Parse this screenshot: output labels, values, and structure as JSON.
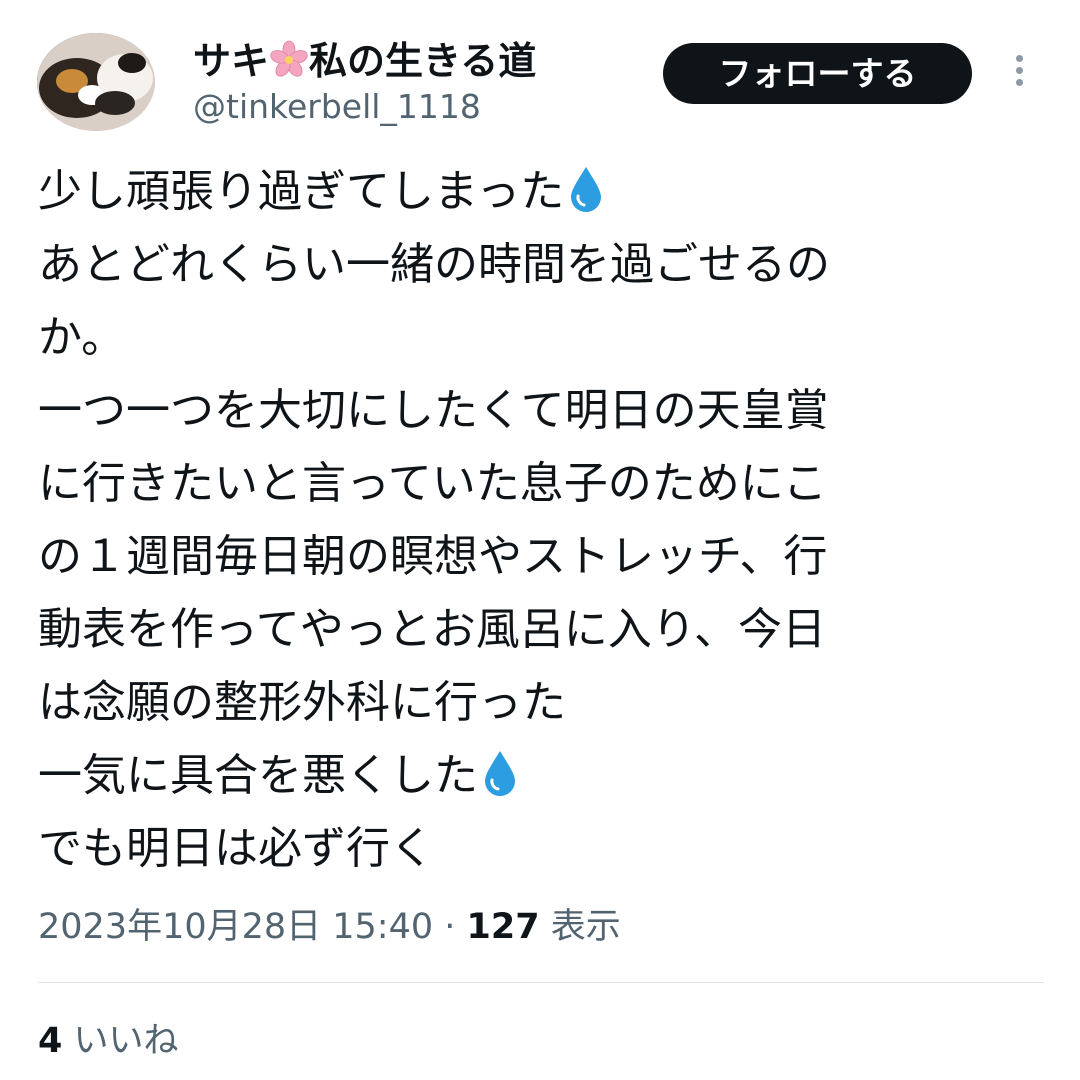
{
  "user": {
    "display_name_before": "サキ",
    "display_name_after": "私の生きる道",
    "handle": "@tinkerbell_1118"
  },
  "actions": {
    "follow_label": "フォローする"
  },
  "tweet": {
    "lines": [
      "少し頑張り過ぎてしまった",
      "あとどれくらい一緒の時間を過ごせるの",
      "か。",
      "一つ一つを大切にしたくて明日の天皇賞",
      "に行きたいと言っていた息子のためにこ",
      "の１週間毎日朝の瞑想やストレッチ、行",
      "動表を作ってやっとお風呂に入り、今日",
      "は念願の整形外科に行った",
      "一気に具合を悪くした",
      "でも明日は必ず行く"
    ]
  },
  "meta": {
    "datetime": "2023年10月28日 15:40",
    "separator": " · ",
    "views_count": "127",
    "views_label": " 表示"
  },
  "stats": {
    "likes_count": "4",
    "likes_label": " いいね"
  },
  "icons": {
    "name_emoji": "cherry-blossom-icon",
    "line_emoji": "droplet-icon"
  },
  "colors": {
    "text_primary": "#0f1419",
    "text_secondary": "#536471",
    "follow_button_bg": "#0f1419",
    "divider": "#dfe3e6",
    "droplet": "#2b9de0",
    "sakura": "#f4a6c0"
  }
}
